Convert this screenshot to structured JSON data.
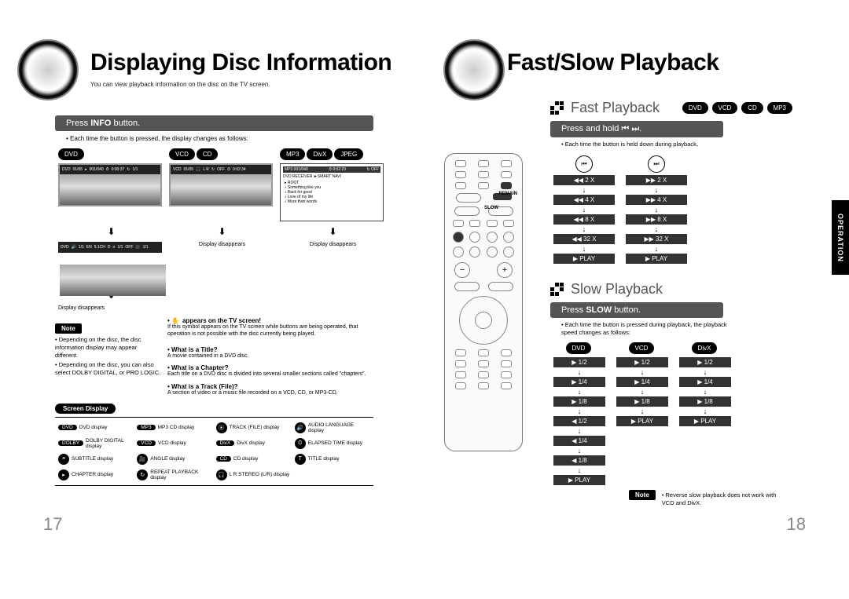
{
  "left": {
    "title": "Displaying Disc Information",
    "subtitle": "You can view playback information on the disc on the TV screen.",
    "instr": {
      "pre": "Press ",
      "strong": "INFO",
      "post": " button."
    },
    "instr_sub": "• Each time the button is pressed, the display changes as follows:",
    "pills": {
      "dvd": "DVD",
      "vcd": "VCD",
      "cd": "CD",
      "mp3": "MP3",
      "divx": "DivX",
      "jpeg": "JPEG"
    },
    "osd_dvd1": [
      "DVD",
      "01/05",
      "001/040",
      "0:00:37",
      "1/1"
    ],
    "osd_dvd2": [
      "DVD",
      "1/1",
      "EN",
      "5.1CH",
      "D",
      "1/1",
      "OFF",
      "1/1"
    ],
    "osd_vcd": [
      "VCD",
      "01/05",
      "L R",
      "OFF",
      "0:02:34"
    ],
    "osd_mp3_top": {
      "left": "MP3  001/040",
      "mid": "0:02:23",
      "right": "OFF"
    },
    "osd_mp3_header": "DVD RECEIVER  ►SMART NAVI",
    "osd_mp3_items": [
      "ROOT",
      "Something like you",
      "Back for good",
      "Love of my life",
      "More than words"
    ],
    "disp_disappears": "Display disappears",
    "note_tag": "Note",
    "note_lines": [
      "• Depending on the disc, the disc information display may appear different.",
      "• Depending on the disc, you can also select DOLBY DIGITAL, or PRO LOGIC."
    ],
    "hand_header": "appears on the TV screen!",
    "hand_body": "If this symbol appears on the TV screen while buttons are being operated, that operation is not possible with the disc currently being played.",
    "defs": {
      "t1h": "• What is a Title?",
      "t1b": "A movie contained in a DVD disc.",
      "t2h": "• What is a Chapter?",
      "t2b": "Each title on a DVD disc is divided into several smaller sections called \"chapters\".",
      "t3h": "• What is a Track (File)?",
      "t3b": "A section of video or a music file recorded on a VCD, CD, or MP3-CD."
    },
    "legend": {
      "header": "Screen Display",
      "items": [
        {
          "tag": "DVD",
          "label": "DVD display"
        },
        {
          "tag": "MP3",
          "label": "MP3 CD display"
        },
        {
          "icon": "⦿",
          "label": "TRACK (FILE) display"
        },
        {
          "icon": "🔊",
          "label": "AUDIO LANGUAGE display"
        },
        {
          "tag": "DOLBY",
          "label": "DOLBY DIGITAL display"
        },
        {
          "tag": "VCD",
          "label": "VCD display"
        },
        {
          "tag": "DivX",
          "label": "DivX display"
        },
        {
          "icon": "⏱",
          "label": "ELAPSED TIME display"
        },
        {
          "icon": "≡",
          "label": "SUBTITLE display"
        },
        {
          "icon": "🎥",
          "label": "ANGLE display"
        },
        {
          "tag": "CD",
          "label": "CD display"
        },
        {
          "icon": "T",
          "label": "TITLE display"
        },
        {
          "icon": "▸",
          "label": "CHAPTER display"
        },
        {
          "icon": "↻",
          "label": "REPEAT PLAYBACK display"
        },
        {
          "icon": "🎧",
          "label": "L R STEREO (L/R) display"
        }
      ]
    },
    "page_num": "17"
  },
  "right": {
    "title": "Fast/Slow Playback",
    "fast": {
      "heading": "Fast Playback",
      "pills": [
        "DVD",
        "VCD",
        "CD",
        "MP3"
      ],
      "instr": {
        "pre": "Press and hold ",
        "post": "."
      },
      "sub": "• Each time the button is held down during playback,",
      "back": [
        "◀◀ 2 X",
        "◀◀ 4 X",
        "◀◀ 8 X",
        "◀◀ 32 X",
        "▶ PLAY"
      ],
      "fwd": [
        "▶▶ 2 X",
        "▶▶ 4 X",
        "▶▶ 8 X",
        "▶▶ 32 X",
        "▶ PLAY"
      ]
    },
    "slow": {
      "heading": "Slow Playback",
      "instr": {
        "pre": "Press ",
        "strong": "SLOW",
        "post": " button."
      },
      "sub": "• Each time the button is pressed during playback, the playback speed changes as follows:",
      "cols": [
        {
          "pill": "DVD",
          "steps": [
            "▶ 1/2",
            "▶ 1/4",
            "▶ 1/8",
            "◀ 1/2",
            "◀ 1/4",
            "◀ 1/8",
            "▶ PLAY"
          ]
        },
        {
          "pill": "VCD",
          "steps": [
            "▶ 1/2",
            "▶ 1/4",
            "▶ 1/8",
            "▶ PLAY"
          ]
        },
        {
          "pill": "DivX",
          "steps": [
            "▶ 1/2",
            "▶ 1/4",
            "▶ 1/8",
            "▶ PLAY"
          ]
        }
      ],
      "note_tag": "Note",
      "note_body": "• Reverse slow playback does not work with VCD and DivX."
    },
    "side_tab": "OPERATION",
    "page_num": "18",
    "remote_labels": {
      "slow": "SLOW",
      "remain": "REMAIN"
    }
  }
}
